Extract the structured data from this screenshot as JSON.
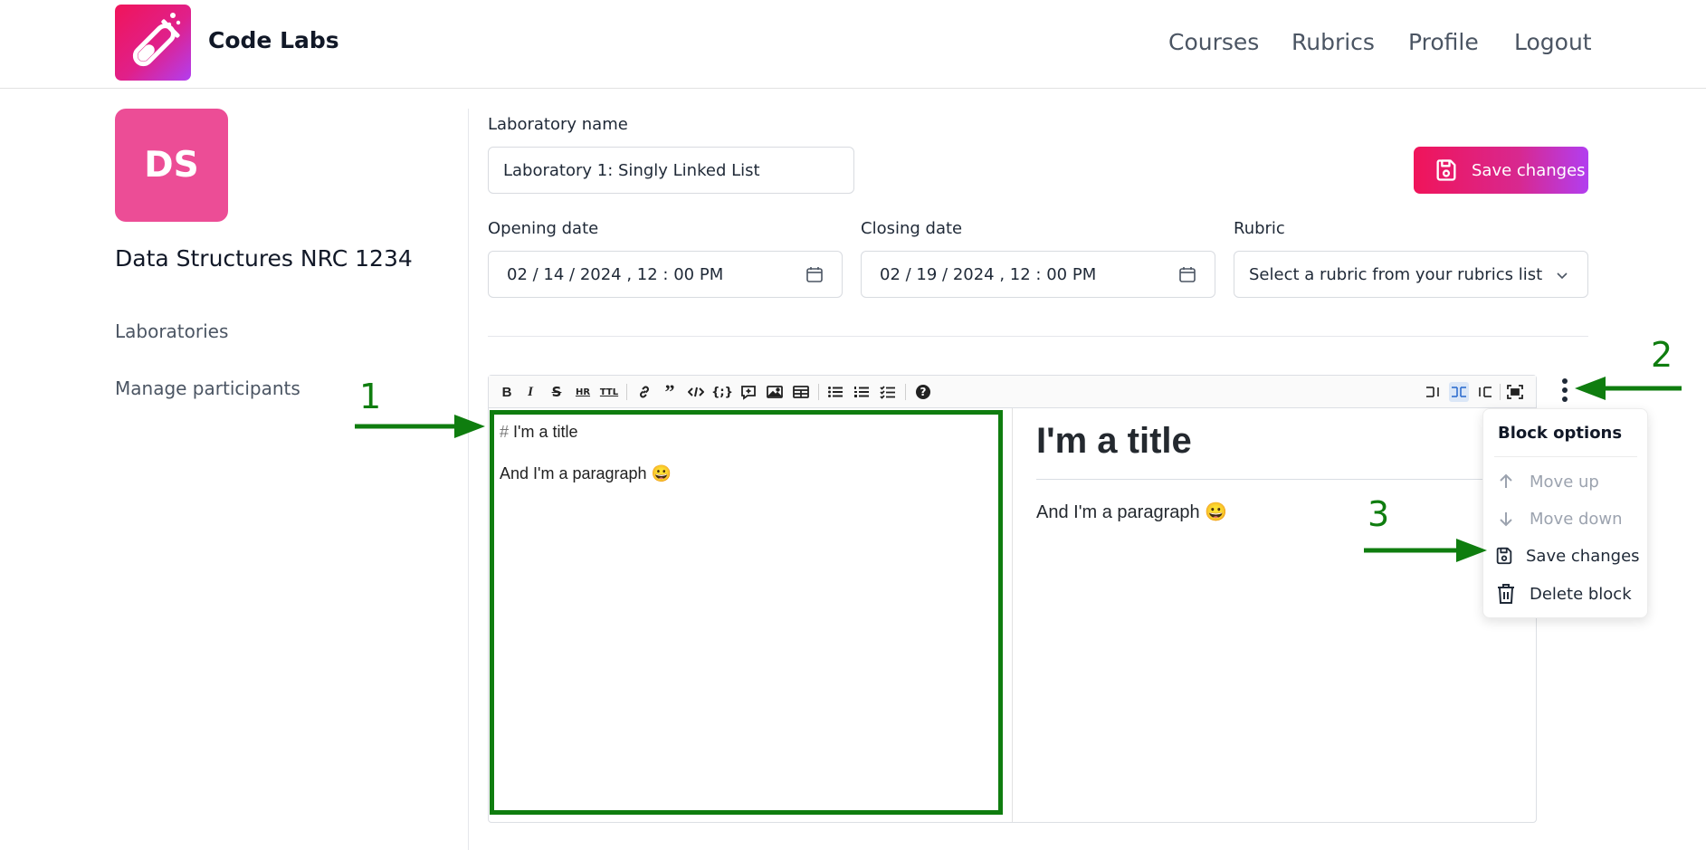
{
  "header": {
    "brand": "Code Labs",
    "nav": [
      "Courses",
      "Rubrics",
      "Profile",
      "Logout"
    ]
  },
  "sidebar": {
    "avatar_initials": "DS",
    "course_title": "Data Structures NRC 1234",
    "links": [
      "Laboratories",
      "Manage participants"
    ]
  },
  "form": {
    "lab_name_label": "Laboratory name",
    "lab_name_value": "Laboratory 1: Singly Linked List",
    "save_label": "Save changes",
    "opening_label": "Opening date",
    "opening_value": "02 / 14 / 2024 ,  12 : 00   PM",
    "closing_label": "Closing date",
    "closing_value": "02 / 19 / 2024 ,  12 : 00   PM",
    "rubric_label": "Rubric",
    "rubric_value": "Select a rubric from your rubrics list"
  },
  "editor": {
    "toolbar_icons": [
      "bold-icon",
      "italic-icon",
      "strikethrough-icon",
      "horizontal-rule-icon",
      "title-icon",
      "link-icon",
      "quote-icon",
      "code-icon",
      "code-block-icon",
      "comment-icon",
      "image-icon",
      "table-icon",
      "unordered-list-icon",
      "ordered-list-icon",
      "checklist-icon",
      "help-icon",
      "edit-mode-icon",
      "live-mode-icon",
      "preview-mode-icon",
      "fullscreen-icon"
    ],
    "markdown_hash": "#",
    "markdown_title": " I'm a title",
    "markdown_paragraph": "And I'm a paragraph 😀",
    "preview_title": "I'm a title",
    "preview_paragraph": "And I'm a paragraph 😀"
  },
  "block_menu": {
    "title": "Block options",
    "items": [
      {
        "label": "Move up",
        "icon": "arrow-up-icon",
        "disabled": true
      },
      {
        "label": "Move down",
        "icon": "arrow-down-icon",
        "disabled": true
      },
      {
        "label": "Save changes",
        "icon": "save-icon",
        "disabled": false
      },
      {
        "label": "Delete block",
        "icon": "trash-icon",
        "disabled": false
      }
    ]
  },
  "annotations": {
    "labels": [
      "1",
      "2",
      "3"
    ],
    "color": "#0f7d0f"
  },
  "colors": {
    "brand_gradient_start": "#f0145a",
    "brand_gradient_end": "#b23ef0",
    "course_avatar": "#ec4d96"
  }
}
